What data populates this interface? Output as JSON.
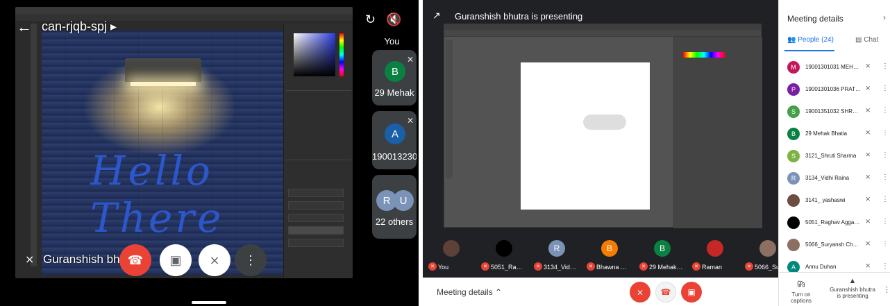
{
  "left": {
    "meeting_code": "can-rjqb-spj",
    "presenter_name": "Guranshish bhutra",
    "hello_text": "Hello There",
    "self_label": "You",
    "tiles": [
      {
        "initial": "B",
        "label": "29 Mehak",
        "color": "#0b8043"
      },
      {
        "initial": "A",
        "label": "190013230...",
        "color": "#1a5fa8"
      }
    ],
    "others": {
      "initials": [
        "R",
        "U"
      ],
      "label": "22 others"
    }
  },
  "right": {
    "presenting_title": "Guranshish bhutra is presenting",
    "strip": [
      {
        "name": "You",
        "initial": "",
        "color": "#5d4037"
      },
      {
        "name": "5051_Raghav ...",
        "initial": "",
        "color": "#000000"
      },
      {
        "name": "3134_Vidhi R...",
        "initial": "R",
        "color": "#7c93b8"
      },
      {
        "name": "Bhawna Bhar...",
        "initial": "B",
        "color": "#f57c00"
      },
      {
        "name": "29 Mehak Bh...",
        "initial": "B",
        "color": "#0b8043"
      },
      {
        "name": "Raman",
        "initial": "",
        "color": "#c62828"
      },
      {
        "name": "5066_Suryan...",
        "initial": "",
        "color": "#8d6e63"
      }
    ],
    "meeting_details_link": "Meeting details",
    "panel": {
      "title": "Meeting details",
      "tab_people": "People (24)",
      "tab_chat": "Chat",
      "people": [
        {
          "initial": "M",
          "name": "19001301031 MEHAK SI...",
          "color": "#c2185b"
        },
        {
          "initial": "P",
          "name": "19001301036 PRATEEK ...",
          "color": "#7b1fa2"
        },
        {
          "initial": "S",
          "name": "19001351032 SHREYA SI...",
          "color": "#43a047"
        },
        {
          "initial": "B",
          "name": "29 Mehak Bhatia",
          "color": "#0b8043"
        },
        {
          "initial": "S",
          "name": "3121_Shruti Sharma",
          "color": "#7cb342"
        },
        {
          "initial": "R",
          "name": "3134_Vidhi Raina",
          "color": "#7c93b8"
        },
        {
          "initial": "",
          "name": "3141_ yashaswi",
          "color": "#6d4c41"
        },
        {
          "initial": "",
          "name": "5051_Raghav Aggarwal",
          "color": "#000000"
        },
        {
          "initial": "",
          "name": "5066_Suryansh Chaudh...",
          "color": "#8d6e63"
        },
        {
          "initial": "A",
          "name": "Annu Duhan",
          "color": "#00897b"
        }
      ],
      "captions_label": "Turn on captions",
      "presenting_label_1": "Guranshish bhutra",
      "presenting_label_2": "is presenting"
    }
  }
}
